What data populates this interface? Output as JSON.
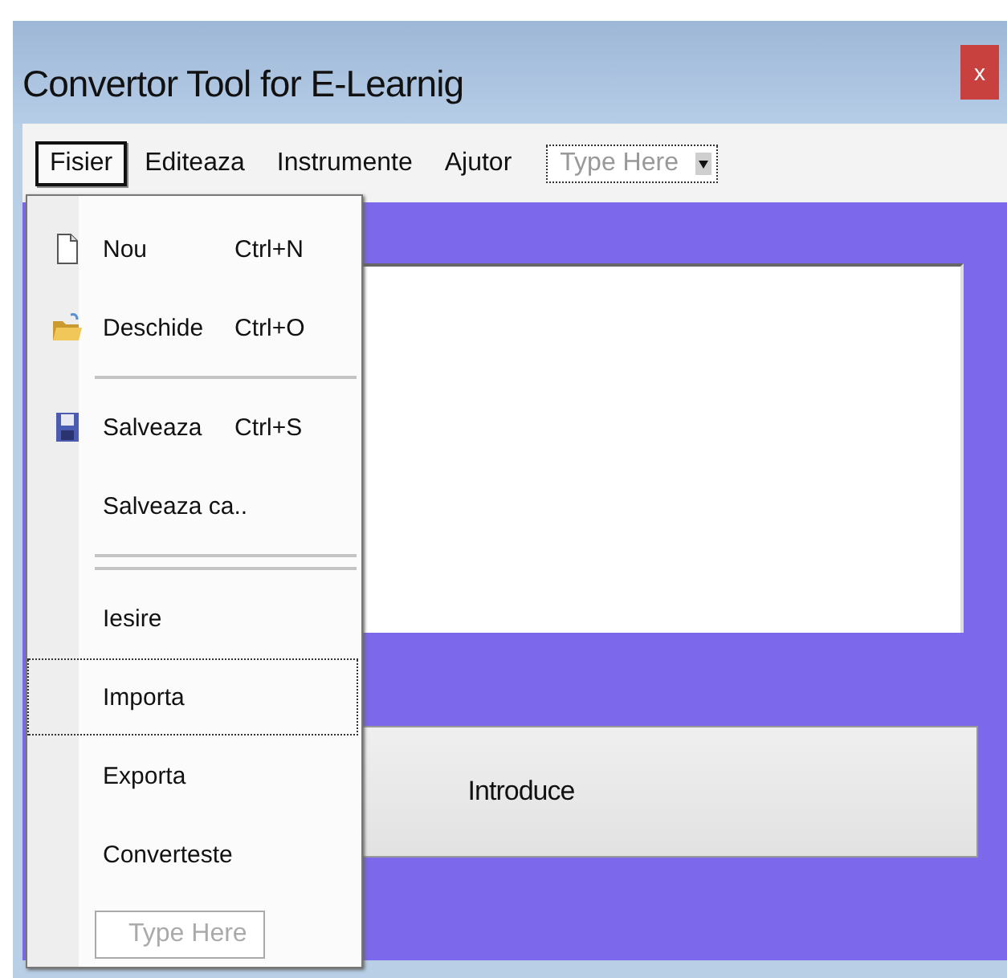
{
  "window": {
    "title": "Convertor Tool for E-Learnig",
    "close_label": "x"
  },
  "menu_bar": {
    "items": [
      {
        "label": "Fisier",
        "selected": true
      },
      {
        "label": "Editeaza",
        "selected": false
      },
      {
        "label": "Instrumente",
        "selected": false
      },
      {
        "label": "Ajutor",
        "selected": false
      }
    ],
    "combo": {
      "placeholder": "Type Here"
    }
  },
  "open_menu": {
    "items": [
      {
        "kind": "new",
        "label": "Nou",
        "shortcut": "Ctrl+N",
        "selected": false
      },
      {
        "kind": "open",
        "label": "Deschide",
        "shortcut": "Ctrl+O",
        "selected": false
      },
      {
        "kind": "separator"
      },
      {
        "kind": "save",
        "label": "Salveaza",
        "shortcut": "Ctrl+S",
        "selected": false
      },
      {
        "kind": "item",
        "label": "Salveaza ca..",
        "selected": false
      },
      {
        "kind": "separator"
      },
      {
        "kind": "separator"
      },
      {
        "kind": "item",
        "label": "Iesire",
        "selected": false
      },
      {
        "kind": "item",
        "label": "Importa",
        "selected": true
      },
      {
        "kind": "item",
        "label": "Exporta",
        "selected": false
      },
      {
        "kind": "item",
        "label": "Converteste",
        "selected": false
      },
      {
        "kind": "field",
        "placeholder": "Type Here"
      }
    ]
  },
  "button": {
    "label": "Introduce"
  }
}
